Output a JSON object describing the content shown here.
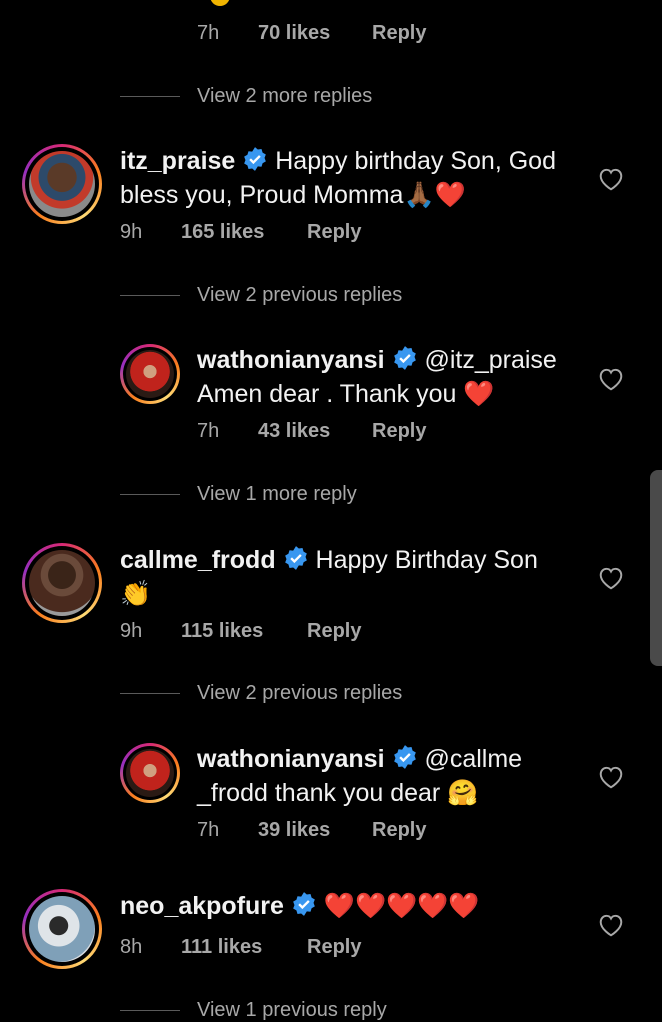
{
  "top_meta": {
    "time": "7h",
    "likes": "70 likes",
    "reply": "Reply"
  },
  "view_more_1": "View 2 more replies",
  "c1": {
    "username": "itz_praise",
    "text_line1": "Happy birthday Son, God",
    "text_line2": "bless you, Proud Momma",
    "emojis": "🙏🏾❤️",
    "time": "9h",
    "likes": "165 likes",
    "reply": "Reply"
  },
  "view_prev_1": "View 2 previous replies",
  "r1": {
    "username": "wathonianyansi",
    "mention": "@itz_praise",
    "text_line2": "Amen dear . Thank you",
    "emoji": "❤️",
    "time": "7h",
    "likes": "43 likes",
    "reply": "Reply"
  },
  "view_more_2": "View 1 more reply",
  "c2": {
    "username": "callme_frodd",
    "text_line1": "Happy Birthday Son",
    "emoji_line2": "👏",
    "time": "9h",
    "likes": "115 likes",
    "reply": "Reply"
  },
  "view_prev_2": "View 2 previous replies",
  "r2": {
    "username": "wathonianyansi",
    "mention_line1": "@callme",
    "mention_line2": "_frodd",
    "text_line2": "thank you dear",
    "emoji": "🤗",
    "time": "7h",
    "likes": "39 likes",
    "reply": "Reply"
  },
  "c3": {
    "username": "neo_akpofure",
    "emojis": "❤️❤️❤️❤️❤️",
    "time": "8h",
    "likes": "111 likes",
    "reply": "Reply"
  },
  "view_prev_3": "View 1 previous reply",
  "colors": {
    "background": "#000000",
    "text": "#f2f2f2",
    "secondary": "#a8a8a8",
    "verified": "#3897f0",
    "heart": "#e0242e"
  }
}
